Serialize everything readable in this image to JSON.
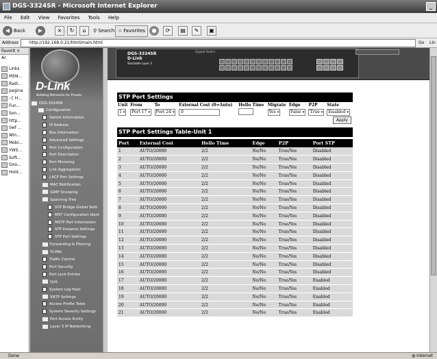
{
  "window": {
    "title": "DGS-3324SR - Microsoft Internet Explorer"
  },
  "menu": [
    "File",
    "Edit",
    "View",
    "Favorites",
    "Tools",
    "Help"
  ],
  "toolbar": {
    "back": "Back",
    "search": "Search",
    "favorites": "Favorites"
  },
  "address": {
    "label": "Address",
    "url": "http://192.168.0.21/html/main.html",
    "go": "Go",
    "links": "Lin"
  },
  "favorites": {
    "header": "Favorit",
    "add": "Ac",
    "items": [
      "Links",
      "MSN...",
      "Radi...",
      "pagina",
      "–{ H...",
      "Fun...",
      "Son...",
      "http...",
      "Swf ...",
      "Win...",
      "Mobi...",
      "YWS...",
      "Soft...",
      "Goo...",
      "Hold..."
    ]
  },
  "logo": {
    "brand": "D-Link",
    "tagline": "Building Networks for People"
  },
  "device": {
    "model": "DGS-3324SR",
    "brand": "D-Link",
    "sub": "Stackable Layer 3",
    "caption": "Gigabit Switch"
  },
  "tree": {
    "root": "DGS-3324SR",
    "items": [
      {
        "label": "Configuration",
        "level": 0,
        "type": "folder"
      },
      {
        "label": "Switch Information",
        "level": 1,
        "type": "page"
      },
      {
        "label": "IP Address",
        "level": 1,
        "type": "page"
      },
      {
        "label": "Box Information",
        "level": 1,
        "type": "page"
      },
      {
        "label": "Advanced Settings",
        "level": 1,
        "type": "page"
      },
      {
        "label": "Port Configuration",
        "level": 1,
        "type": "page"
      },
      {
        "label": "Port Description",
        "level": 1,
        "type": "page"
      },
      {
        "label": "Port Mirroring",
        "level": 1,
        "type": "page"
      },
      {
        "label": "Link Aggregation",
        "level": 1,
        "type": "page"
      },
      {
        "label": "LACP Port Settings",
        "level": 1,
        "type": "page"
      },
      {
        "label": "MAC Notification",
        "level": 1,
        "type": "folder"
      },
      {
        "label": "IGMP Snooping",
        "level": 1,
        "type": "folder"
      },
      {
        "label": "Spanning Tree",
        "level": 1,
        "type": "folder"
      },
      {
        "label": "STP Bridge Global Setti",
        "level": 2,
        "type": "page"
      },
      {
        "label": "MST Configuration Ident",
        "level": 2,
        "type": "page"
      },
      {
        "label": "MSTP Port Information",
        "level": 2,
        "type": "page"
      },
      {
        "label": "STP Instance Settings",
        "level": 2,
        "type": "page"
      },
      {
        "label": "STP Port Settings",
        "level": 2,
        "type": "page"
      },
      {
        "label": "Forwarding & Filtering",
        "level": 1,
        "type": "folder"
      },
      {
        "label": "VLANs",
        "level": 1,
        "type": "folder"
      },
      {
        "label": "Traffic Control",
        "level": 1,
        "type": "page"
      },
      {
        "label": "Port Security",
        "level": 1,
        "type": "page"
      },
      {
        "label": "Port Lock Entries",
        "level": 1,
        "type": "page"
      },
      {
        "label": "QoS",
        "level": 1,
        "type": "folder"
      },
      {
        "label": "System Log Host",
        "level": 1,
        "type": "page"
      },
      {
        "label": "SNTP Settings",
        "level": 1,
        "type": "folder"
      },
      {
        "label": "Access Profile Table",
        "level": 1,
        "type": "page"
      },
      {
        "label": "System Severity Settings",
        "level": 1,
        "type": "page"
      },
      {
        "label": "Port Access Entity",
        "level": 1,
        "type": "folder"
      },
      {
        "label": "Layer 3 IP Networking",
        "level": 1,
        "type": "folder"
      }
    ]
  },
  "stp_settings": {
    "title": "STP Port Settings",
    "headers": {
      "unit": "Unit",
      "from": "From",
      "to": "To",
      "cost": "External Cost (0=Auto)",
      "hello": "Hello Time",
      "migrate": "Migrate",
      "edge": "Edge",
      "p2p": "P2P",
      "state": "State"
    },
    "values": {
      "unit": "1",
      "from": "Port 17",
      "to": "Port 24",
      "cost": "0",
      "hello": "",
      "migrate": "Yes",
      "edge": "False",
      "p2p": "True",
      "state": "Enabled"
    },
    "apply": "Apply"
  },
  "port_table": {
    "title": "STP Port Settings Table-Unit 1",
    "headers": [
      "Port",
      "External Cost",
      "Hello Time",
      "Edge",
      "P2P",
      "Port STP"
    ],
    "rows": [
      [
        "1",
        "AUTO/20000",
        "2/2",
        "No/No",
        "True/Yes",
        "Disabled"
      ],
      [
        "2",
        "AUTO/20000",
        "2/2",
        "No/No",
        "True/Yes",
        "Disabled"
      ],
      [
        "3",
        "AUTO/20000",
        "2/2",
        "No/No",
        "True/Yes",
        "Disabled"
      ],
      [
        "4",
        "AUTO/20000",
        "2/2",
        "No/No",
        "True/Yes",
        "Disabled"
      ],
      [
        "5",
        "AUTO/20000",
        "2/2",
        "No/No",
        "True/Yes",
        "Disabled"
      ],
      [
        "6",
        "AUTO/20000",
        "2/2",
        "No/No",
        "True/Yes",
        "Disabled"
      ],
      [
        "7",
        "AUTO/20000",
        "2/2",
        "No/No",
        "True/Yes",
        "Disabled"
      ],
      [
        "8",
        "AUTO/20000",
        "2/2",
        "No/No",
        "True/Yes",
        "Disabled"
      ],
      [
        "9",
        "AUTO/20000",
        "2/2",
        "No/No",
        "True/Yes",
        "Disabled"
      ],
      [
        "10",
        "AUTO/20000",
        "2/2",
        "No/No",
        "True/Yes",
        "Disabled"
      ],
      [
        "11",
        "AUTO/20000",
        "2/2",
        "No/No",
        "True/Yes",
        "Disabled"
      ],
      [
        "12",
        "AUTO/20000",
        "2/2",
        "No/No",
        "True/Yes",
        "Disabled"
      ],
      [
        "13",
        "AUTO/20000",
        "2/2",
        "No/No",
        "True/Yes",
        "Disabled"
      ],
      [
        "14",
        "AUTO/20000",
        "2/2",
        "No/No",
        "True/Yes",
        "Disabled"
      ],
      [
        "15",
        "AUTO/20000",
        "2/2",
        "No/No",
        "True/Yes",
        "Disabled"
      ],
      [
        "16",
        "AUTO/20000",
        "2/2",
        "No/No",
        "True/Yes",
        "Disabled"
      ],
      [
        "17",
        "AUTO/20000",
        "2/2",
        "No/No",
        "True/Yes",
        "Enabled"
      ],
      [
        "18",
        "AUTO/20000",
        "2/2",
        "No/No",
        "True/Yes",
        "Enabled"
      ],
      [
        "19",
        "AUTO/20000",
        "2/2",
        "No/No",
        "True/Yes",
        "Enabled"
      ],
      [
        "20",
        "AUTO/20000",
        "2/2",
        "No/No",
        "True/Yes",
        "Enabled"
      ],
      [
        "21",
        "AUTO/20000",
        "2/2",
        "No/No",
        "True/Yes",
        "Enabled"
      ]
    ]
  },
  "status": {
    "left": "Done",
    "right": "Internet"
  }
}
